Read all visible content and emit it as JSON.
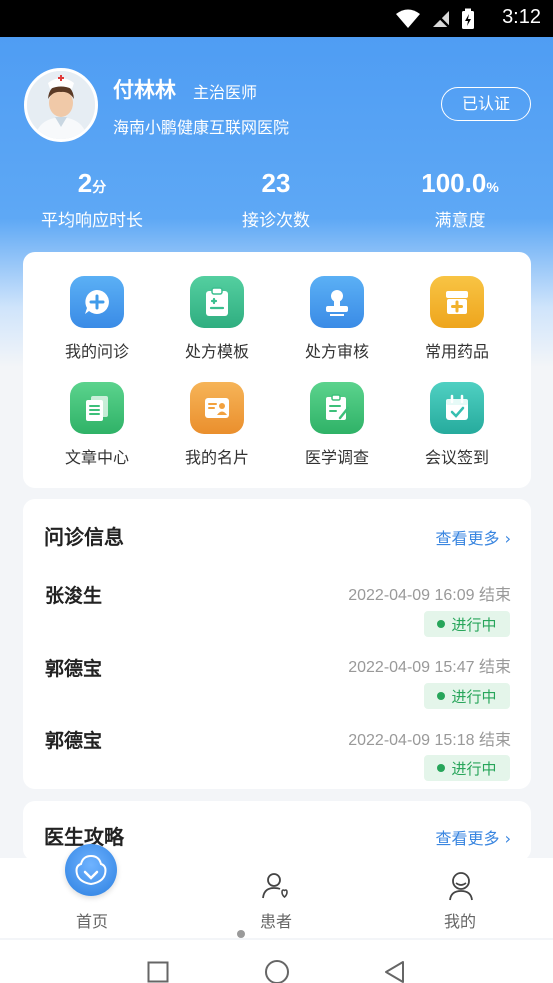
{
  "status_bar": {
    "time": "3:12"
  },
  "profile": {
    "name": "付林林",
    "title": "主治医师",
    "hospital": "海南小鹏健康互联网医院",
    "verified_label": "已认证"
  },
  "stats": [
    {
      "value": "2",
      "unit": "分",
      "label": "平均响应时长"
    },
    {
      "value": "23",
      "unit": "",
      "label": "接诊次数"
    },
    {
      "value": "100.0",
      "unit": "%",
      "label": "满意度"
    }
  ],
  "features": [
    {
      "label": "我的问诊",
      "icon": "chat-plus-icon",
      "color": "#3f9bea"
    },
    {
      "label": "处方模板",
      "icon": "clipboard-icon",
      "color": "#3bbf8f"
    },
    {
      "label": "处方审核",
      "icon": "stamp-icon",
      "color": "#3f9bea"
    },
    {
      "label": "常用药品",
      "icon": "medicine-box-icon",
      "color": "#f2b22c"
    },
    {
      "label": "文章中心",
      "icon": "documents-icon",
      "color": "#3cc07a"
    },
    {
      "label": "我的名片",
      "icon": "id-card-icon",
      "color": "#f2a13e"
    },
    {
      "label": "医学调查",
      "icon": "survey-icon",
      "color": "#3cc07a"
    },
    {
      "label": "会议签到",
      "icon": "calendar-check-icon",
      "color": "#36bfb1"
    }
  ],
  "consultation": {
    "title": "问诊信息",
    "more_label": "查看更多",
    "items": [
      {
        "name": "张浚生",
        "time": "2022-04-09 16:09 结束",
        "status": "进行中"
      },
      {
        "name": "郭德宝",
        "time": "2022-04-09 15:47 结束",
        "status": "进行中"
      },
      {
        "name": "郭德宝",
        "time": "2022-04-09 15:18 结束",
        "status": "进行中"
      }
    ]
  },
  "guide": {
    "title": "医生攻略",
    "more_label": "查看更多"
  },
  "tabbar": [
    {
      "label": "首页",
      "icon": "home-icon"
    },
    {
      "label": "患者",
      "icon": "patient-icon"
    },
    {
      "label": "我的",
      "icon": "profile-icon"
    }
  ]
}
